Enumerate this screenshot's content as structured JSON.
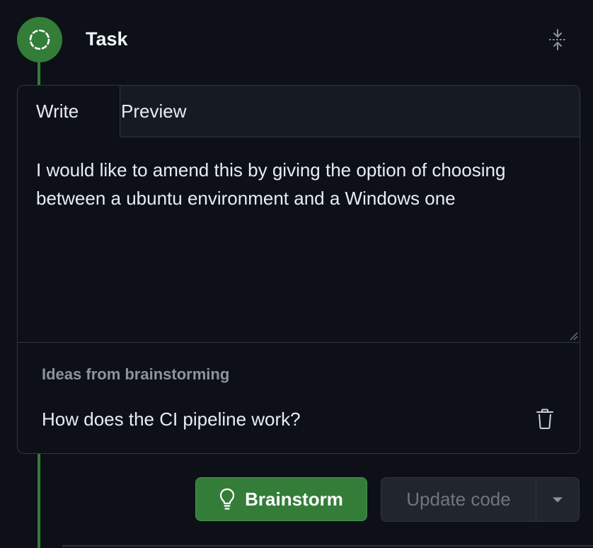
{
  "task": {
    "title": "Task",
    "status_icon": "dashed-circle-icon",
    "collapse_icon": "fold-icon"
  },
  "editor": {
    "tabs": [
      {
        "label": "Write",
        "active": true
      },
      {
        "label": "Preview",
        "active": false
      }
    ],
    "text": "I would like to amend this by giving the option of choosing between a ubuntu environment and a Windows one"
  },
  "ideas": {
    "heading": "Ideas from brainstorming",
    "items": [
      {
        "text": "How does the CI pipeline work?",
        "action_icon": "trash-icon"
      }
    ]
  },
  "actions": {
    "brainstorm_label": "Brainstorm",
    "brainstorm_icon": "lightbulb-icon",
    "update_label": "Update code",
    "dropdown_icon": "triangle-down-icon"
  },
  "colors": {
    "accent_green": "#347d39",
    "background": "#0d1117",
    "border": "#30363d"
  }
}
